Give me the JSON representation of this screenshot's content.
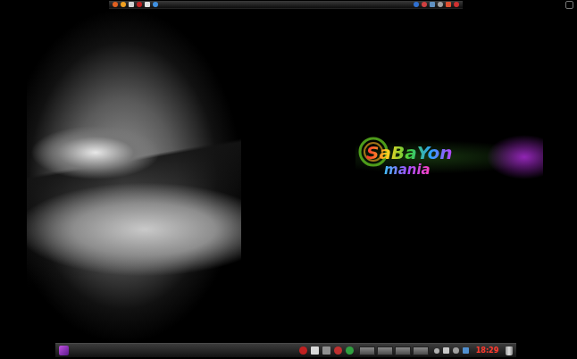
{
  "desktop": {
    "wallpaper": {
      "logo": {
        "words": [
          "SaBaYon",
          "mania"
        ]
      }
    }
  },
  "bottom_panel": {
    "clock": {
      "time": "18:29"
    }
  }
}
